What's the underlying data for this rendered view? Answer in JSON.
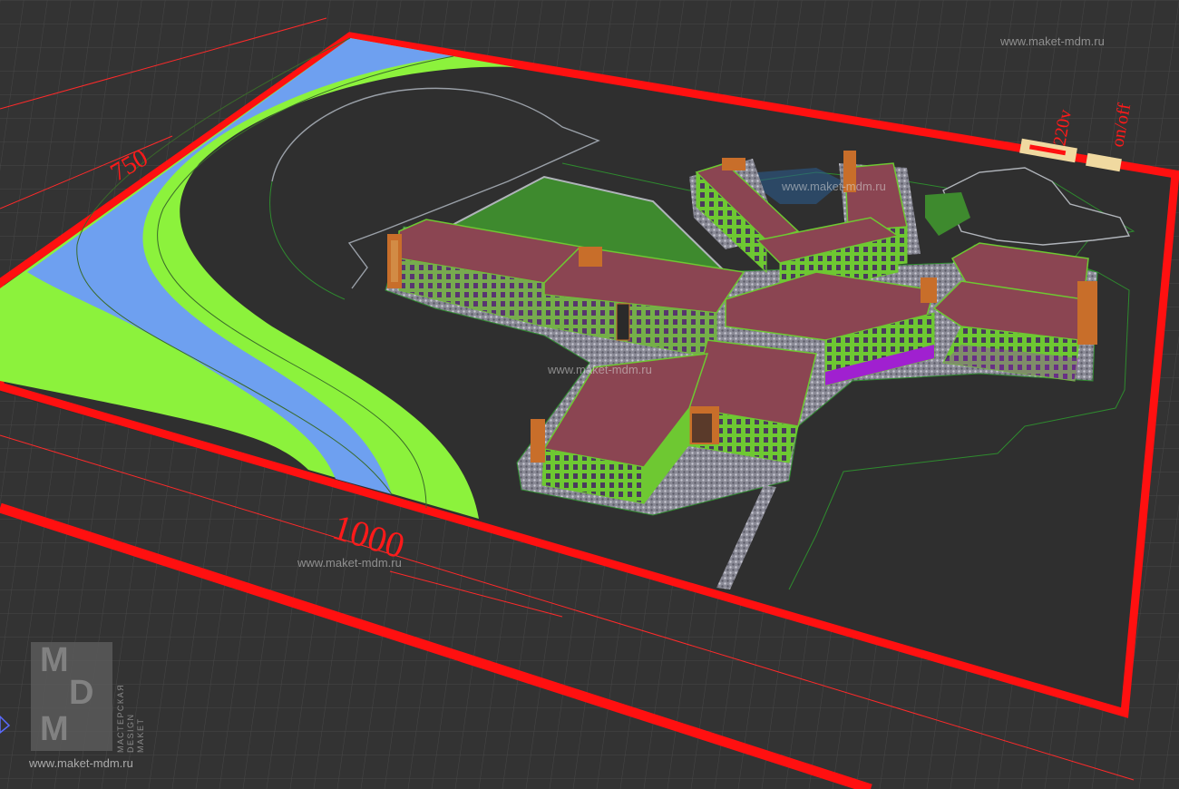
{
  "dimensions": {
    "width_label": "1000",
    "depth_label": "750"
  },
  "control_labels": {
    "power": "220v",
    "switch": "on/off"
  },
  "watermarks": [
    "www.maket-mdm.ru",
    "www.maket-mdm.ru",
    "www.maket-mdm.ru",
    "www.maket-mdm.ru"
  ],
  "logo": {
    "letters": [
      "M",
      "D",
      "M"
    ],
    "side_lines": [
      "МАСТЕРСКАЯ",
      "DESIGN",
      "MAKET"
    ],
    "url": "www.maket-mdm.ru"
  },
  "colors": {
    "background": "#333333",
    "grid": "#454545",
    "frame": "#ff1010",
    "river": "#6ea0f0",
    "grass": "#8cf23c",
    "roof": "#8b4552",
    "facade": "#6ec832",
    "windows": "#a020d0",
    "accent": "#c86e2a"
  }
}
